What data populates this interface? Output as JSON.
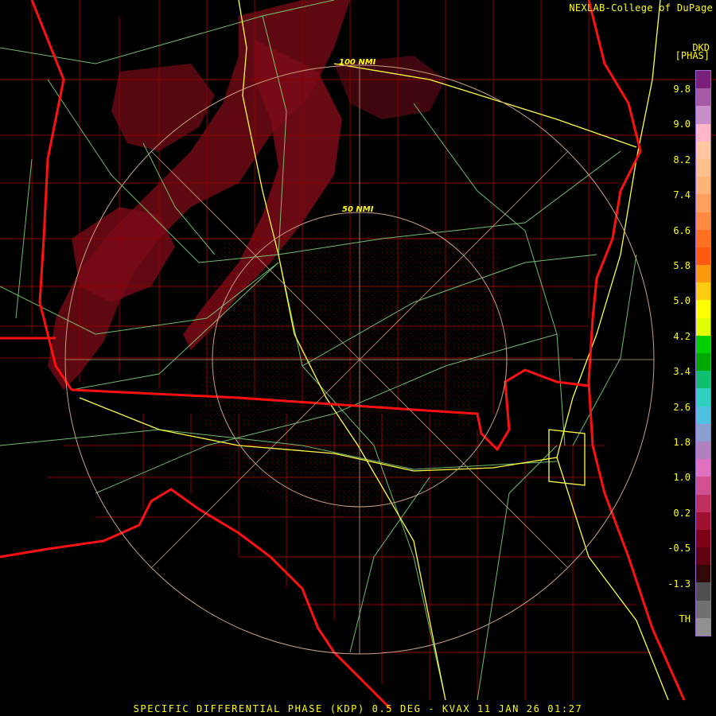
{
  "header": {
    "credit": "NEXLAB-College of DuPage"
  },
  "legend": {
    "units_top": "DKD",
    "units_bottom": "[PHAS]",
    "labels": [
      "9.8",
      "9.0",
      "8.2",
      "7.4",
      "6.6",
      "5.8",
      "5.0",
      "4.2",
      "3.4",
      "2.6",
      "1.8",
      "1.0",
      "0.2",
      "-0.5",
      "-1.3",
      "TH"
    ],
    "colors": [
      "#7a1f7a",
      "#a45aa4",
      "#c88fc8",
      "#ffb6c8",
      "#ffc8a0",
      "#ffc08a",
      "#ffb478",
      "#ffa060",
      "#ff8a40",
      "#ff7020",
      "#ff5a10",
      "#ff9a10",
      "#ffcc10",
      "#ffff00",
      "#e0ff00",
      "#00d000",
      "#00a800",
      "#10c070",
      "#30d0c0",
      "#50c0e0",
      "#8a9fd0",
      "#b080c0",
      "#e070c0",
      "#d05090",
      "#c03060",
      "#a01030",
      "#800018",
      "#600010",
      "#300808",
      "#505050",
      "#707070",
      "#909090"
    ]
  },
  "map": {
    "range_rings": [
      "100 NMI",
      "50 NMI"
    ]
  },
  "footer": {
    "caption": "SPECIFIC DIFFERENTIAL PHASE (KDP) 0.5 DEG - KVAX 11 JAN 26 01:27"
  }
}
